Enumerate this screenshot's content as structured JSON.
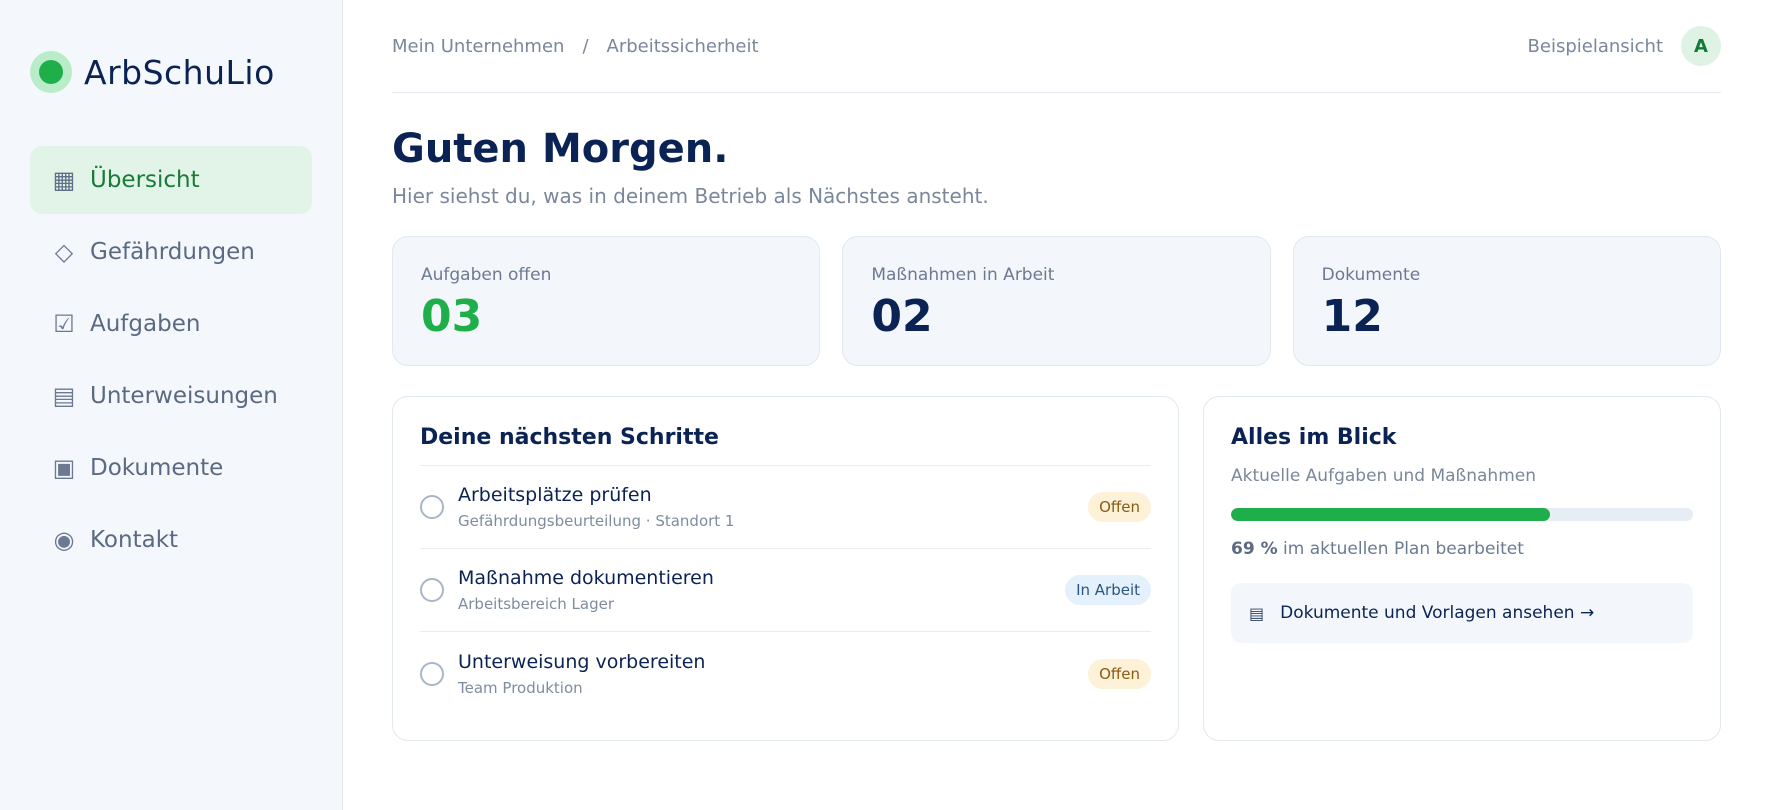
{
  "brand": {
    "name": "ArbSchuLio",
    "accent": "#1eaf4a"
  },
  "sidebar": {
    "items": [
      {
        "label": "Übersicht",
        "icon": "grid-icon",
        "glyph": "▦",
        "active": true
      },
      {
        "label": "Gefährdungen",
        "icon": "diamond-icon",
        "glyph": "◇",
        "active": false
      },
      {
        "label": "Aufgaben",
        "icon": "checkbox-icon",
        "glyph": "☑",
        "active": false
      },
      {
        "label": "Unterweisungen",
        "icon": "list-icon",
        "glyph": "▤",
        "active": false
      },
      {
        "label": "Dokumente",
        "icon": "document-icon",
        "glyph": "▣",
        "active": false
      },
      {
        "label": "Kontakt",
        "icon": "contact-icon",
        "glyph": "◉",
        "active": false
      }
    ]
  },
  "header": {
    "breadcrumb": [
      "Mein Unternehmen",
      "/",
      "Arbeitssicherheit"
    ],
    "view_label": "Beispielansicht",
    "avatar": "A"
  },
  "main": {
    "title": "Guten Morgen.",
    "subtitle": "Hier siehst du, was in deinem Betrieb als Nächstes ansteht.",
    "stats": [
      {
        "label": "Aufgaben offen",
        "value": "03"
      },
      {
        "label": "Maßnahmen in Arbeit",
        "value": "02"
      },
      {
        "label": "Dokumente",
        "value": "12"
      }
    ],
    "steps": {
      "title": "Deine nächsten Schritte",
      "items": [
        {
          "title": "Arbeitsplätze prüfen",
          "meta": "Gefährdungsbeurteilung · Standort 1",
          "status": "Offen"
        },
        {
          "title": "Maßnahme dokumentieren",
          "meta": "Arbeitsbereich Lager",
          "status": "In Arbeit"
        },
        {
          "title": "Unterweisung vorbereiten",
          "meta": "Team Produktion",
          "status": "Offen"
        }
      ]
    },
    "overview": {
      "title": "Alles im Blick",
      "subtitle": "Aktuelle Aufgaben und Maßnahmen",
      "progress_percent": 69,
      "progress_value": "69 %",
      "progress_text": " im aktuellen Plan bearbeitet",
      "link_label": "Dokumente und Vorlagen ansehen →",
      "link_icon": "document-icon"
    }
  }
}
